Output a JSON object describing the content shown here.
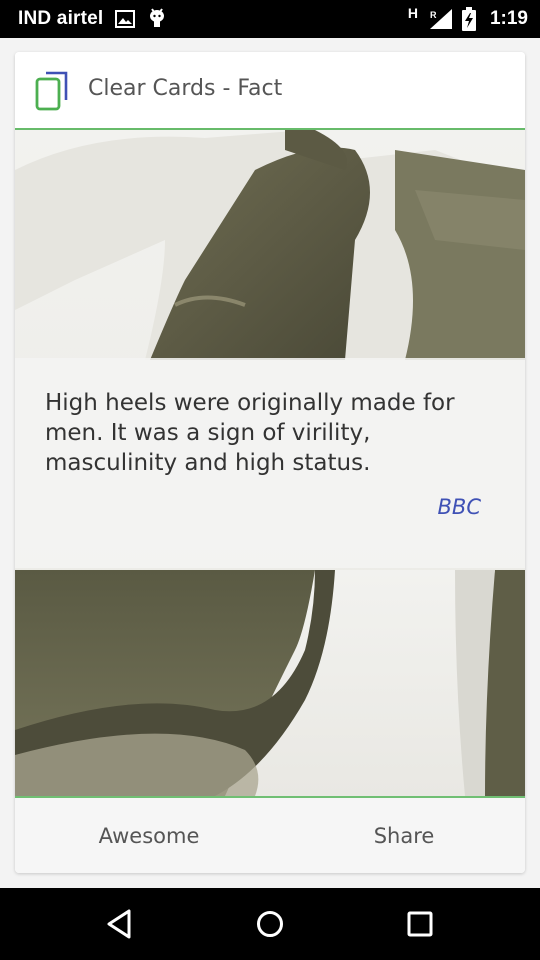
{
  "status_bar": {
    "carrier": "IND airtel",
    "network_type": "H",
    "roaming": "R",
    "time": "1:19",
    "icons": [
      "gallery-icon",
      "android-debug-icon",
      "signal-icon",
      "battery-charging-icon"
    ]
  },
  "card": {
    "app_title": "Clear Cards - Fact",
    "app_icon": "cards-icon",
    "fact_text": "High heels were originally made for men. It was a sign of virility, masculinity and high status.",
    "source": "BBC",
    "image": "vintage-high-heel-shoe-photo",
    "actions": {
      "awesome_label": "Awesome",
      "share_label": "Share"
    },
    "colors": {
      "accent_green": "#4caf50",
      "source_blue": "#3f51b5"
    }
  },
  "nav_bar": {
    "icons": [
      "back-icon",
      "home-icon",
      "recents-icon"
    ]
  }
}
